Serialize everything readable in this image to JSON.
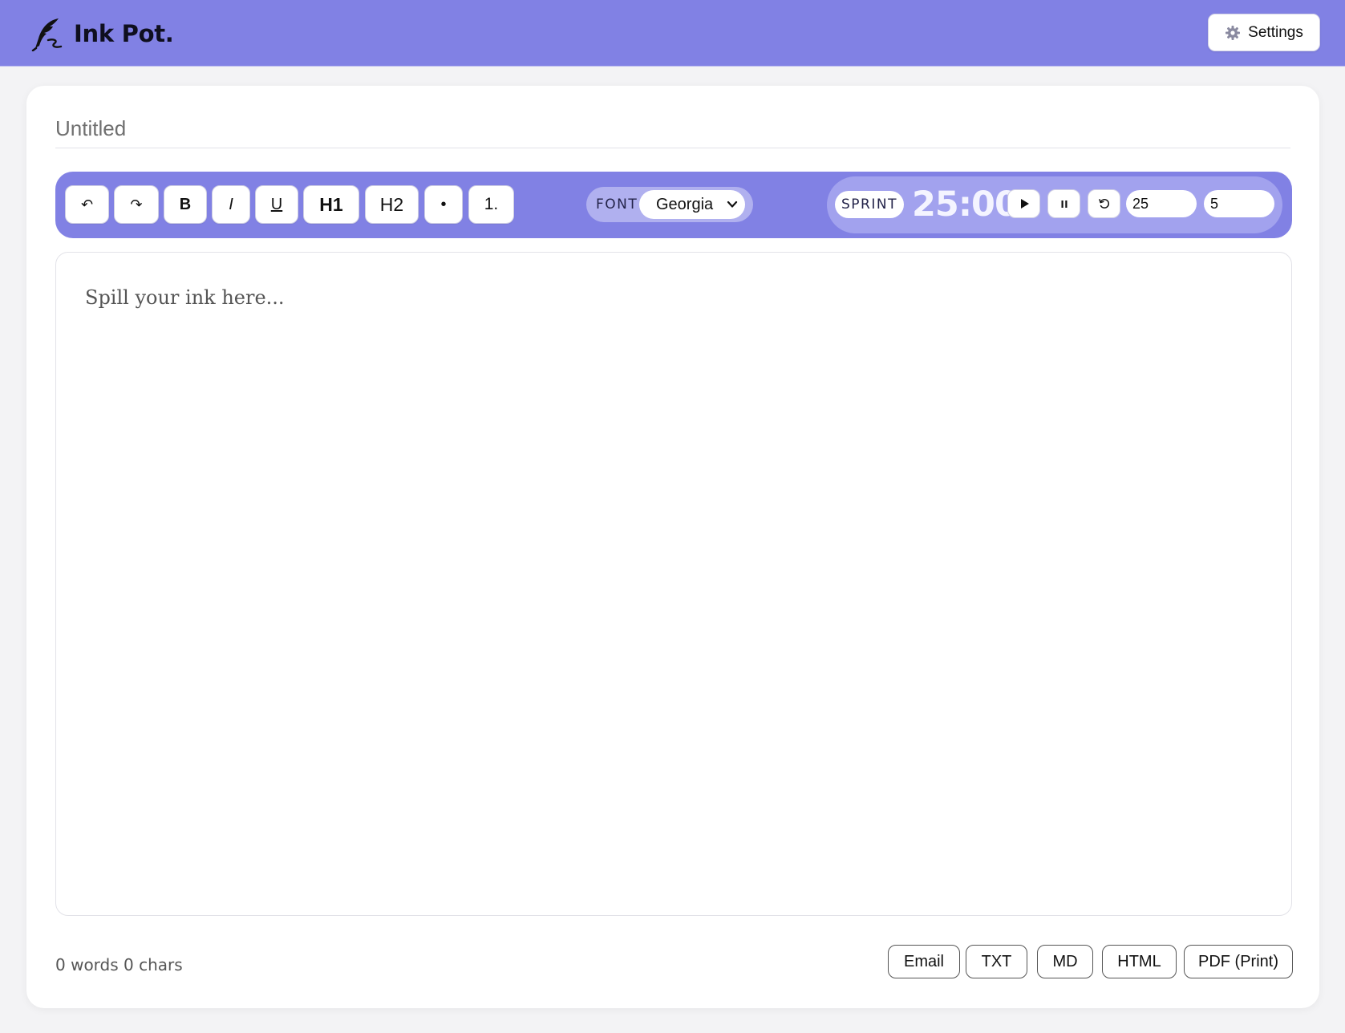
{
  "app": {
    "name": "Ink Pot.",
    "brand_icon": "quill-icon",
    "accent_color": "#8181e4"
  },
  "header": {
    "settings_label": "Settings",
    "settings_icon": "gear-icon"
  },
  "document": {
    "title_placeholder": "Untitled",
    "editor_placeholder": "Spill your ink here..."
  },
  "toolbar": {
    "buttons": [
      {
        "id": "undo",
        "label": "↶",
        "icon": "undo-icon"
      },
      {
        "id": "redo",
        "label": "↷",
        "icon": "redo-icon"
      },
      {
        "id": "bold",
        "label": "B"
      },
      {
        "id": "italic",
        "label": "I"
      },
      {
        "id": "underline",
        "label": "U"
      },
      {
        "id": "h1",
        "label": "H1"
      },
      {
        "id": "h2",
        "label": "H2"
      },
      {
        "id": "bullet-list",
        "label": "•"
      },
      {
        "id": "numbered-list",
        "label": "1."
      }
    ],
    "font": {
      "label": "FONT",
      "selected": "Georgia"
    }
  },
  "sprint": {
    "label": "SPRINT",
    "timer": "25:00",
    "play_icon": "play-icon",
    "pause_icon": "pause-icon",
    "reset_icon": "reset-icon",
    "work_minutes": "25",
    "break_minutes": "5"
  },
  "footer": {
    "counts": "0 words 0 chars",
    "exports": [
      "Email",
      "TXT",
      "MD",
      "HTML",
      "PDF (Print)"
    ]
  }
}
